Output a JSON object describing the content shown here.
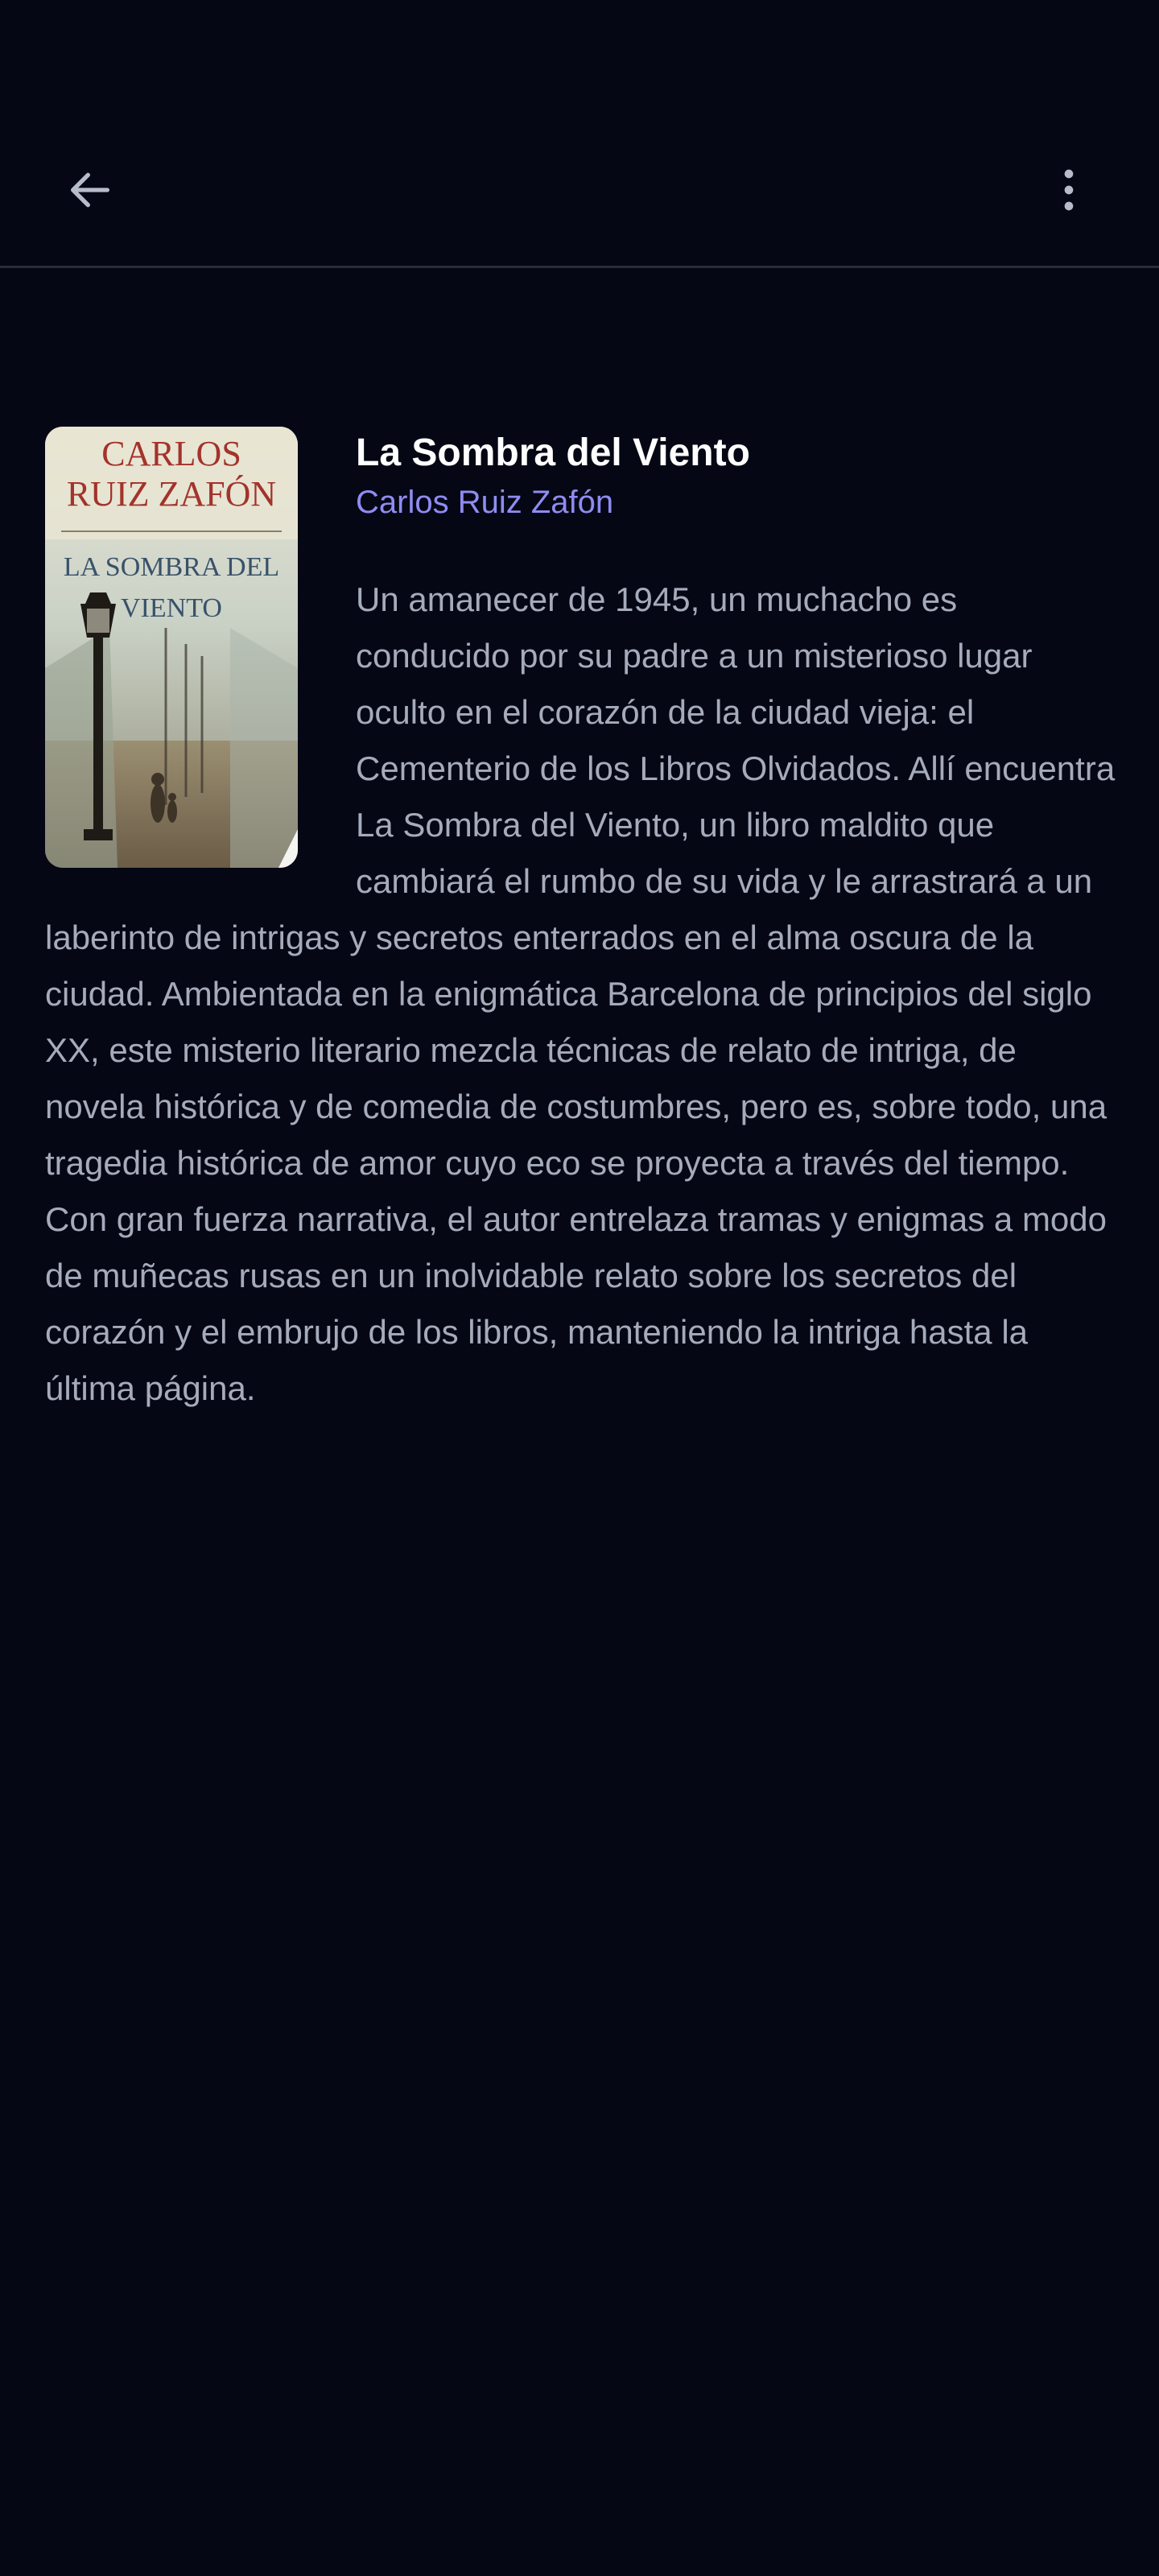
{
  "toolbar": {
    "back_icon": "arrow-left-icon",
    "menu_icon": "more-vertical-icon"
  },
  "book": {
    "title": "La Sombra del Viento",
    "author": "Carlos Ruiz Zafón",
    "description": "Un amanecer de 1945, un muchacho es conducido por su padre a un misterioso lugar oculto en el corazón de la ciudad vieja: el Cementerio de los Libros Olvidados. Allí encuentra La Sombra del Viento, un libro maldito que cambiará el rumbo de su vida y le arrastrará a un laberinto de intrigas y secretos enterrados en el alma oscura de la ciudad. Ambientada en la enigmática Barcelona de principios del siglo XX, este misterio literario mezcla técnicas de relato de intriga, de novela histórica y de comedia de costumbres, pero es, sobre todo, una tragedia histórica de amor cuyo eco se proyecta a través del tiempo. Con gran fuerza narrativa, el autor entrelaza tramas y enigmas a modo de muñecas rusas en un inolvidable relato sobre los secretos del corazón y el embrujo de los libros, manteniendo la intriga hasta la última página.",
    "cover": {
      "author_line1": "CARLOS",
      "author_line2": "RUIZ ZAFÓN",
      "title_line1": "LA SOMBRA DEL",
      "title_line2": "VIENTO"
    }
  },
  "colors": {
    "background": "#050714",
    "title": "#ffffff",
    "author_link": "#8f8cf2",
    "body_text": "#a6abbb",
    "divider": "#2a2d39"
  }
}
